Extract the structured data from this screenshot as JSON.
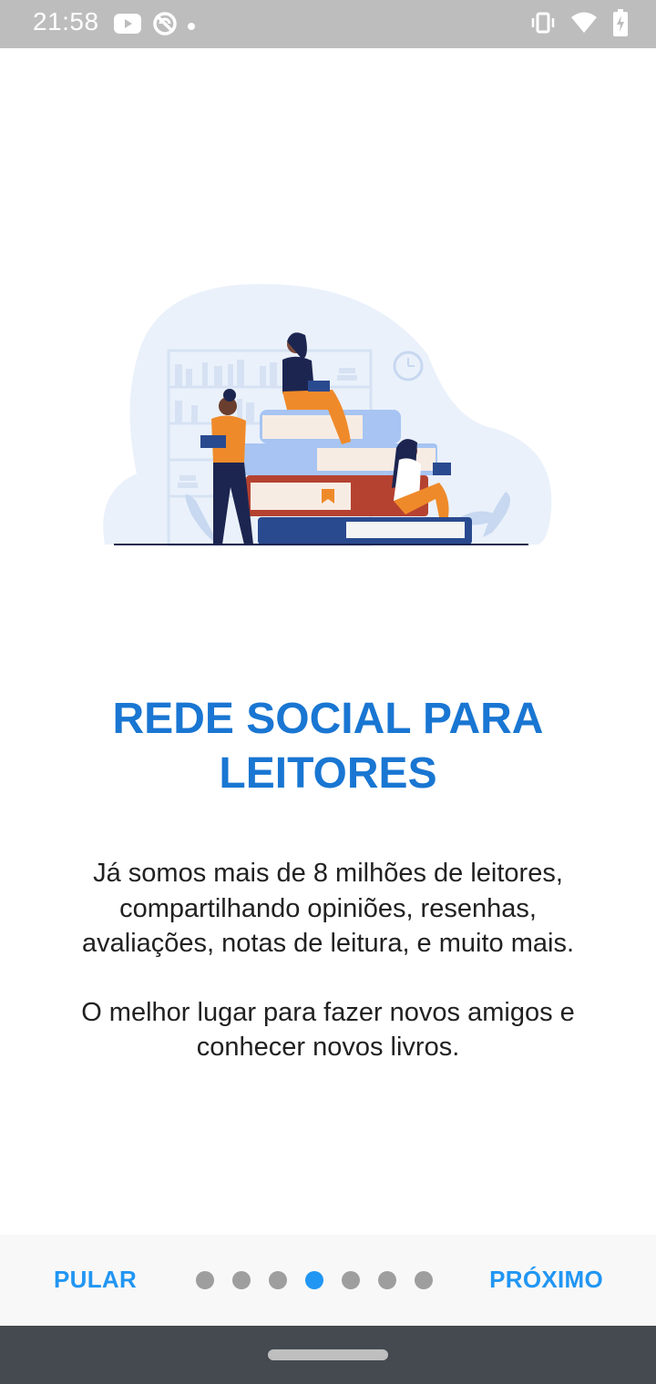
{
  "status_bar": {
    "time": "21:58",
    "left_icons": [
      "youtube-icon",
      "sync-off-icon",
      "notification-dot-icon"
    ],
    "right_icons": [
      "vibrate-icon",
      "wifi-icon",
      "battery-charging-icon"
    ]
  },
  "onboarding": {
    "title": "REDE SOCIAL PARA LEITORES",
    "paragraph1": "Já somos mais de 8 milhões de leitores, compartilhando opiniões, resenhas, avaliações, notas de leitura, e muito mais.",
    "paragraph2": "O melhor lugar para fazer novos amigos e conhecer novos livros.",
    "illustration": "people-reading-books-illustration"
  },
  "footer": {
    "skip_label": "PULAR",
    "next_label": "PRÓXIMO",
    "page_count": 7,
    "current_page": 4
  },
  "colors": {
    "accent": "#1976d2",
    "button_text": "#2196f3",
    "dot_inactive": "#9e9e9e",
    "status_bar": "#bdbdbd",
    "nav_bar": "#454a50"
  }
}
